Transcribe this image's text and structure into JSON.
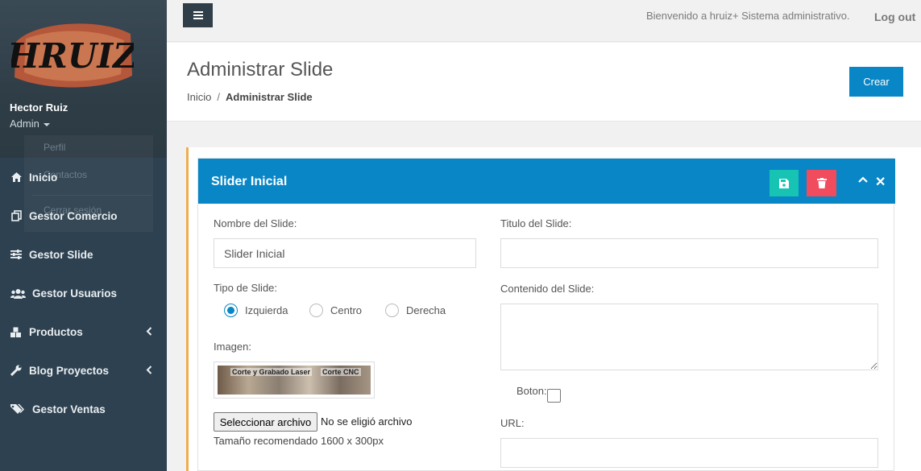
{
  "sidebar": {
    "logo_text": "HRUIZ",
    "user_name": "Hector Ruiz",
    "user_role": "Admin",
    "ghost_items": [
      "Perfil",
      "Contactos",
      "Cerrar sesión"
    ],
    "items": [
      {
        "label": "Inicio",
        "icon": "home-icon",
        "submenu": false
      },
      {
        "label": "Gestor Comercio",
        "icon": "copy-icon",
        "submenu": false
      },
      {
        "label": "Gestor Slide",
        "icon": "sliders-icon",
        "submenu": false
      },
      {
        "label": "Gestor Usuarios",
        "icon": "users-icon",
        "submenu": false
      },
      {
        "label": "Productos",
        "icon": "cubes-icon",
        "submenu": true
      },
      {
        "label": "Blog Proyectos",
        "icon": "wrench-icon",
        "submenu": true
      },
      {
        "label": "Gestor Ventas",
        "icon": "tags-icon",
        "submenu": false
      }
    ]
  },
  "topbar": {
    "welcome": "Bienvenido a hruiz+ Sistema administrativo.",
    "logout": "Log out"
  },
  "header": {
    "title": "Administrar Slide",
    "breadcrumb": {
      "home": "Inicio",
      "separator": "/",
      "current": "Administrar Slide"
    },
    "create_button": "Crear"
  },
  "panel": {
    "title": "Slider Inicial",
    "form": {
      "name_label": "Nombre del Slide:",
      "name_value": "Slider Inicial",
      "type_label": "Tipo de Slide:",
      "type_options": [
        "Izquierda",
        "Centro",
        "Derecha"
      ],
      "type_selected": "Izquierda",
      "image_label": "Imagen:",
      "image_caption_left": "Corte y Grabado Laser",
      "image_caption_right": "Corte CNC",
      "file_button": "Seleccionar archivo",
      "file_status": "No se eligió archivo",
      "size_hint": "Tamaño recomendado 1600 x 300px",
      "title_label": "Titulo del Slide:",
      "title_value": "",
      "content_label": "Contenido del Slide:",
      "content_value": "",
      "button_label": "Boton:",
      "button_checked": false,
      "url_label": "URL:",
      "url_value": ""
    }
  },
  "colors": {
    "sidebar_bg": "#2e4150",
    "primary": "#0886c6",
    "save": "#17c3b2",
    "delete": "#f14b5e",
    "accent_border": "#f0ad4e"
  }
}
